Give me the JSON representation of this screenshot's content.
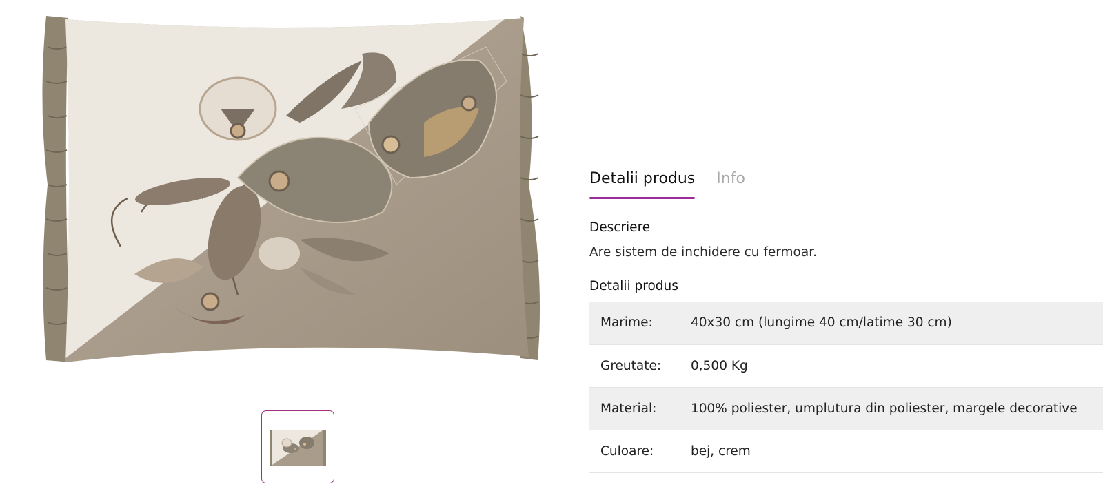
{
  "gallery": {
    "main_image": {
      "alt_icon": "embroidered-pillow-image"
    },
    "thumbnails": [
      {
        "icon": "pillow-thumbnail",
        "selected": true
      }
    ],
    "thumbnail_border_color": "#a0307f"
  },
  "tabs": [
    {
      "label": "Detalii produs",
      "active": true
    },
    {
      "label": "Info",
      "active": false
    }
  ],
  "accent_color": "#9b2c98",
  "description": {
    "title": "Descriere",
    "text": "Are sistem de inchidere cu fermoar."
  },
  "details": {
    "title": "Detalii produs",
    "rows": [
      {
        "key": "Marime:",
        "value": "40x30 cm (lungime 40 cm/latime 30 cm)"
      },
      {
        "key": "Greutate:",
        "value": "0,500 Kg"
      },
      {
        "key": "Material:",
        "value": "100% poliester, umplutura din poliester, margele decorative"
      },
      {
        "key": "Culoare:",
        "value": "bej, crem"
      }
    ]
  }
}
